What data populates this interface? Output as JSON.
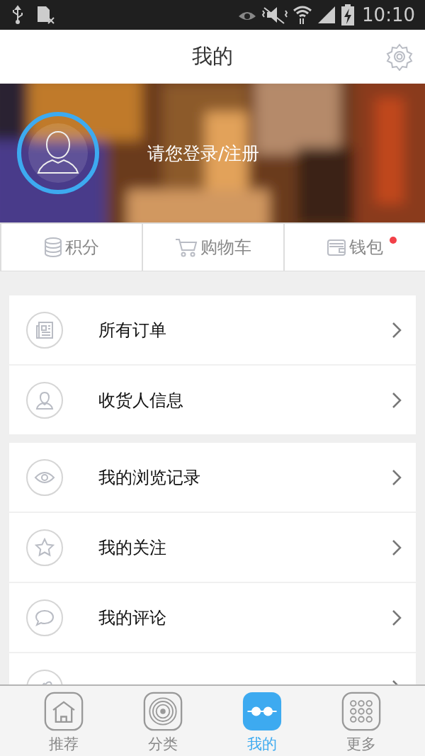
{
  "status_bar": {
    "time": "10:10"
  },
  "header": {
    "title": "我的"
  },
  "profile": {
    "login_text": "请您登录/注册"
  },
  "quick_links": [
    {
      "label": "积分",
      "dot": false
    },
    {
      "label": "购物车",
      "dot": false
    },
    {
      "label": "钱包",
      "dot": true
    }
  ],
  "menu_groups": [
    {
      "items": [
        {
          "label": "所有订单"
        },
        {
          "label": "收货人信息"
        }
      ]
    },
    {
      "items": [
        {
          "label": "我的浏览记录"
        },
        {
          "label": "我的关注"
        },
        {
          "label": "我的评论"
        }
      ]
    }
  ],
  "tab_bar": [
    {
      "label": "推荐",
      "selected": false
    },
    {
      "label": "分类",
      "selected": false
    },
    {
      "label": "我的",
      "selected": true
    },
    {
      "label": "更多",
      "selected": false
    }
  ]
}
